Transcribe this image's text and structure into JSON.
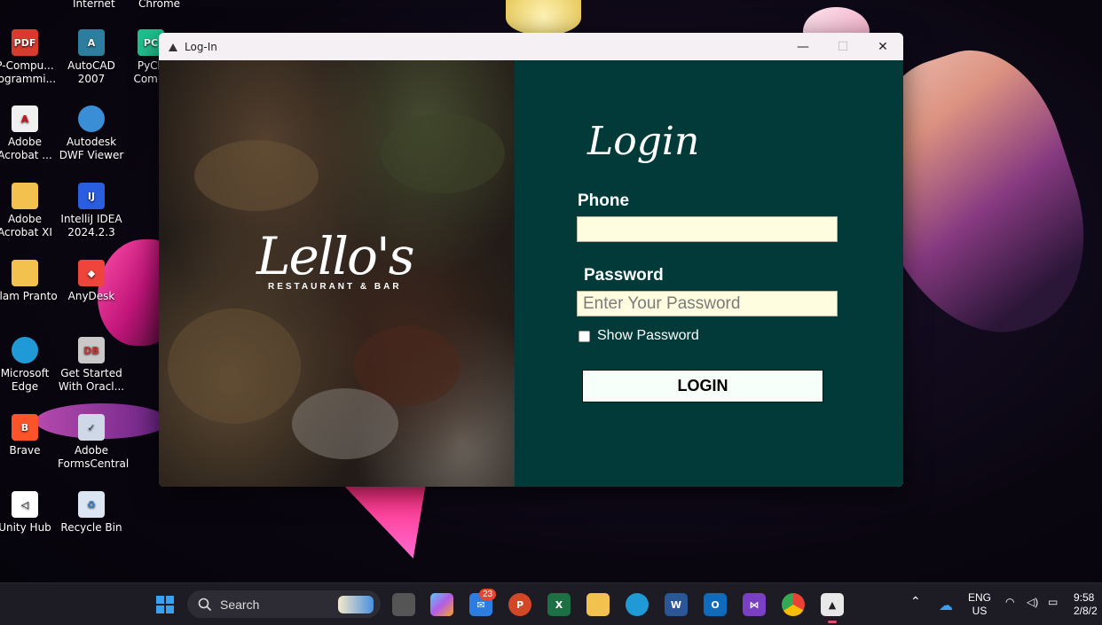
{
  "desktop": {
    "top_labels": [
      "Internet",
      "Chrome"
    ],
    "icons": [
      {
        "label": "P-Compu... rogrammi...",
        "icon": "pdf-file-icon",
        "color": "#d83b2e"
      },
      {
        "label": "AutoCAD 2007",
        "icon": "autocad-icon",
        "color": "#2d7e9e"
      },
      {
        "label": "PyCh Comm",
        "icon": "pycharm-icon",
        "color": "#21c08e"
      },
      {
        "label": "Adobe Acrobat ...",
        "icon": "adobe-acrobat-icon",
        "color": "#e9e9e9"
      },
      {
        "label": "Autodesk DWF Viewer",
        "icon": "autodesk-dwf-icon",
        "color": "#3a8ed6"
      },
      {
        "label": "Adobe Acrobat XI",
        "icon": "folder-icon",
        "color": "#f2c14e"
      },
      {
        "label": "IntelliJ IDEA 2024.2.3",
        "icon": "intellij-icon",
        "color": "#2a5de0"
      },
      {
        "label": "Alam Pranto",
        "icon": "folder-icon",
        "color": "#f2c14e"
      },
      {
        "label": "AnyDesk",
        "icon": "anydesk-icon",
        "color": "#ef443b"
      },
      {
        "label": "Microsoft Edge",
        "icon": "edge-icon",
        "color": "#1f9ad6"
      },
      {
        "label": "Get Started With Oracl...",
        "icon": "oracle-db-icon",
        "color": "#c9c9c9"
      },
      {
        "label": "Brave",
        "icon": "brave-icon",
        "color": "#fb542b"
      },
      {
        "label": "Adobe FormsCentral",
        "icon": "adobe-forms-icon",
        "color": "#cfd8e6"
      },
      {
        "label": "Unity Hub",
        "icon": "unity-hub-icon",
        "color": "#ffffff"
      },
      {
        "label": "Recycle Bin",
        "icon": "recycle-bin-icon",
        "color": "#dbe6f2"
      }
    ]
  },
  "window": {
    "title": "Log-In",
    "controls": {
      "minimize": "—",
      "maximize": "☐",
      "close": "✕"
    }
  },
  "brand": {
    "name": "Lello's",
    "tagline": "RESTAURANT & BAR"
  },
  "form": {
    "heading": "Login",
    "phone_label": "Phone",
    "phone_value": "",
    "password_label": "Password",
    "password_placeholder": "Enter Your Password",
    "show_password_label": "Show Password",
    "show_password_checked": false,
    "login_button": "LOGIN"
  },
  "colors": {
    "panel_bg": "#013a39",
    "input_bg": "#fffde0",
    "button_bg": "#f6fffa"
  },
  "taskbar": {
    "search_placeholder": "Search",
    "mail_badge": "23",
    "apps": [
      "start-icon",
      "search-icon",
      "task-view-icon",
      "copilot-icon",
      "mail-icon",
      "powerpoint-icon",
      "excel-icon",
      "file-explorer-icon",
      "edge-icon",
      "word-icon",
      "outlook-icon",
      "visual-studio-icon",
      "chrome-icon",
      "login-app-icon"
    ],
    "language": "ENG",
    "region": "US",
    "time": "9:58",
    "date": "2/8/2"
  }
}
